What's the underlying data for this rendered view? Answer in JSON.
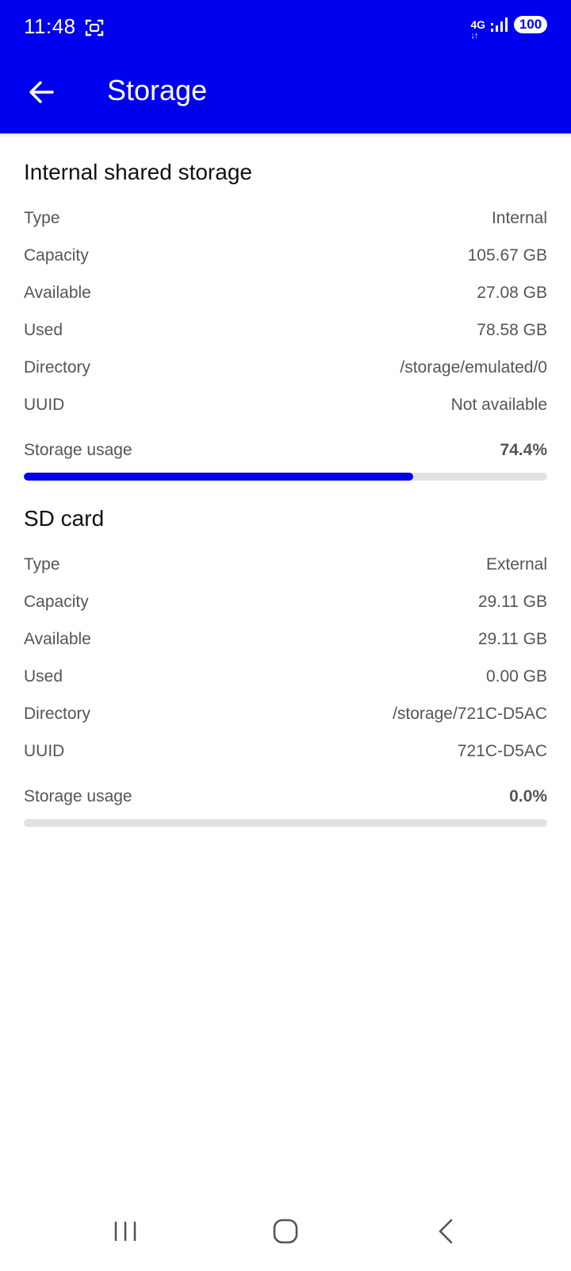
{
  "status_bar": {
    "time": "11:48",
    "network": "4G",
    "battery": "100"
  },
  "toolbar": {
    "title": "Storage",
    "back_icon": "arrow-left-icon"
  },
  "colors": {
    "accent": "#0000f0",
    "progress_fill": "#0000e6",
    "progress_track": "#e2e2e2"
  },
  "sections": [
    {
      "title": "Internal shared storage",
      "rows": [
        {
          "label": "Type",
          "value": "Internal"
        },
        {
          "label": "Capacity",
          "value": "105.67 GB"
        },
        {
          "label": "Available",
          "value": "27.08 GB"
        },
        {
          "label": "Used",
          "value": "78.58 GB"
        },
        {
          "label": "Directory",
          "value": "/storage/emulated/0"
        },
        {
          "label": "UUID",
          "value": "Not available"
        }
      ],
      "usage_label": "Storage usage",
      "usage_value": "74.4%",
      "usage_fraction": 0.744
    },
    {
      "title": "SD card",
      "rows": [
        {
          "label": "Type",
          "value": "External"
        },
        {
          "label": "Capacity",
          "value": "29.11 GB"
        },
        {
          "label": "Available",
          "value": "29.11 GB"
        },
        {
          "label": "Used",
          "value": "0.00 GB"
        },
        {
          "label": "Directory",
          "value": "/storage/721C-D5AC"
        },
        {
          "label": "UUID",
          "value": "721C-D5AC"
        }
      ],
      "usage_label": "Storage usage",
      "usage_value": "0.0%",
      "usage_fraction": 0.0
    }
  ],
  "nav_bar": {
    "recents_icon": "recents-icon",
    "home_icon": "home-icon",
    "back_icon": "back-chevron-icon"
  }
}
